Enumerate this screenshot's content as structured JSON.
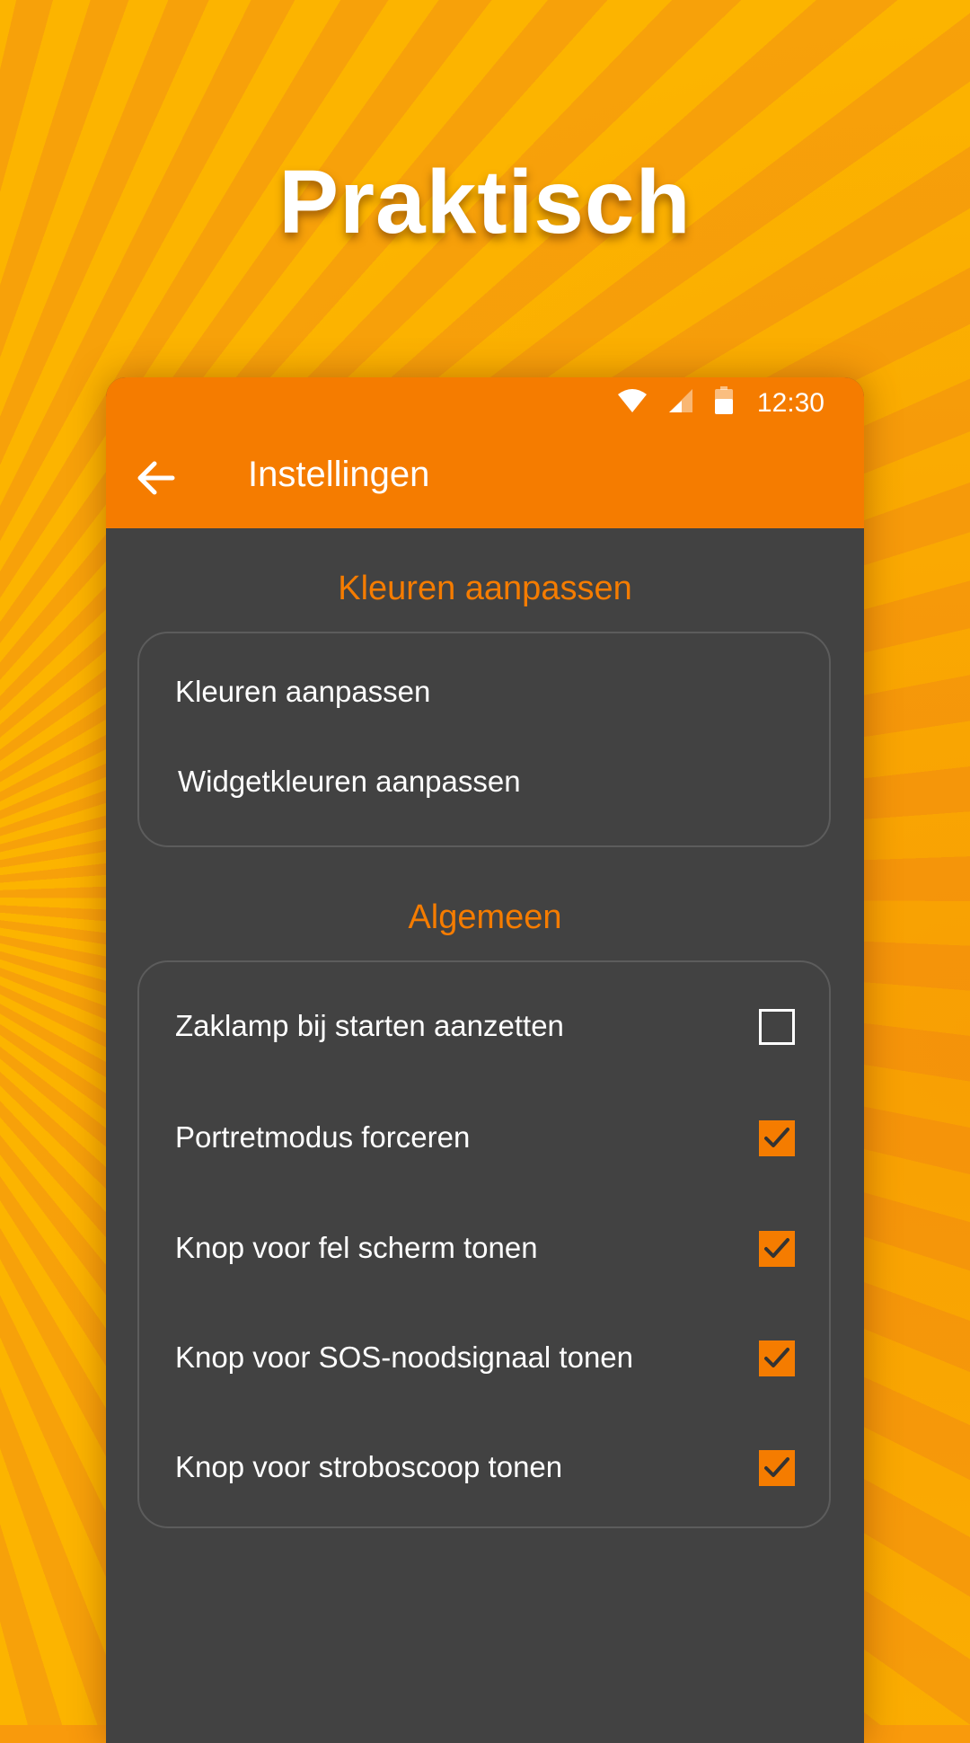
{
  "headline": "Praktisch",
  "status_bar": {
    "time": "12:30",
    "icons": [
      "wifi-icon",
      "cell-signal-icon",
      "battery-icon"
    ]
  },
  "app_bar": {
    "title": "Instellingen",
    "back_icon": "arrow-left-icon"
  },
  "colors": {
    "accent": "#f57c00",
    "surface": "#424242",
    "text": "#ffffff",
    "background": "#fcb400"
  },
  "sections": {
    "colors": {
      "title": "Kleuren aanpassen",
      "items": [
        "Kleuren aanpassen",
        "Widgetkleuren aanpassen"
      ]
    },
    "general": {
      "title": "Algemeen",
      "options": [
        {
          "label": "Zaklamp bij starten aanzetten",
          "checked": false
        },
        {
          "label": "Portretmodus forceren",
          "checked": true
        },
        {
          "label": "Knop voor fel scherm tonen",
          "checked": true
        },
        {
          "label": "Knop voor SOS-noodsignaal tonen",
          "checked": true
        },
        {
          "label": "Knop voor stroboscoop tonen",
          "checked": true
        }
      ]
    }
  }
}
